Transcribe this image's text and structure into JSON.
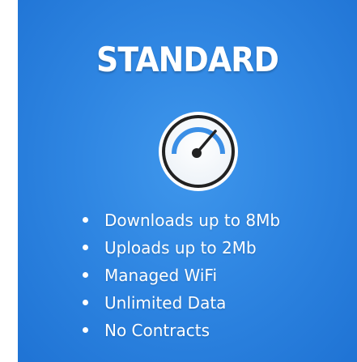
{
  "plan": {
    "title": "STANDARD",
    "icon": "speedometer-icon",
    "features": [
      "Downloads up to 8Mb",
      "Uploads up to 2Mb",
      "Managed WiFi",
      "Unlimited Data",
      "No Contracts"
    ]
  },
  "colors": {
    "card_background": "#2f86e2",
    "text": "#ffffff",
    "gauge_arc": "#3b8fe6",
    "gauge_ring": "#222222"
  }
}
